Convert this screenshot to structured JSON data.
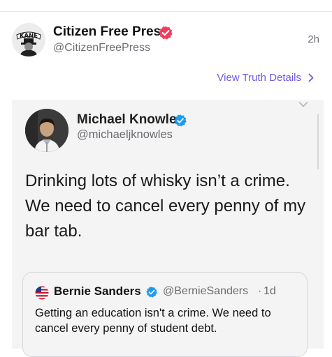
{
  "post": {
    "author_name": "Citizen Free Press",
    "author_handle": "@CitizenFreePress",
    "timestamp": "2h",
    "avatar_logo_text": "KANE",
    "view_details_label": "View Truth Details",
    "verified_color": "#ef3d5b",
    "link_color": "#6b5be3"
  },
  "embedded_tweet": {
    "author_name": "Michael Knowles",
    "author_handle": "@michaeljknowles",
    "text": "Drinking lots of whisky isn’t a crime. We need to cancel every penny of my bar tab.",
    "verified_color": "#1d9bf0"
  },
  "quoted_tweet": {
    "author_name": "Bernie Sanders",
    "author_handle": "@BernieSanders",
    "separator": "·",
    "timestamp": "1d",
    "text": "Getting an education isn't a crime. We need to cancel every penny of student debt."
  },
  "icons": {
    "post_verified": "verified-badge-icon",
    "details_chevron": "chevron-right-icon",
    "tweet_verified": "verified-check-icon",
    "flag": "us-flag-icon",
    "embed_menu": "chevron-down-icon"
  }
}
